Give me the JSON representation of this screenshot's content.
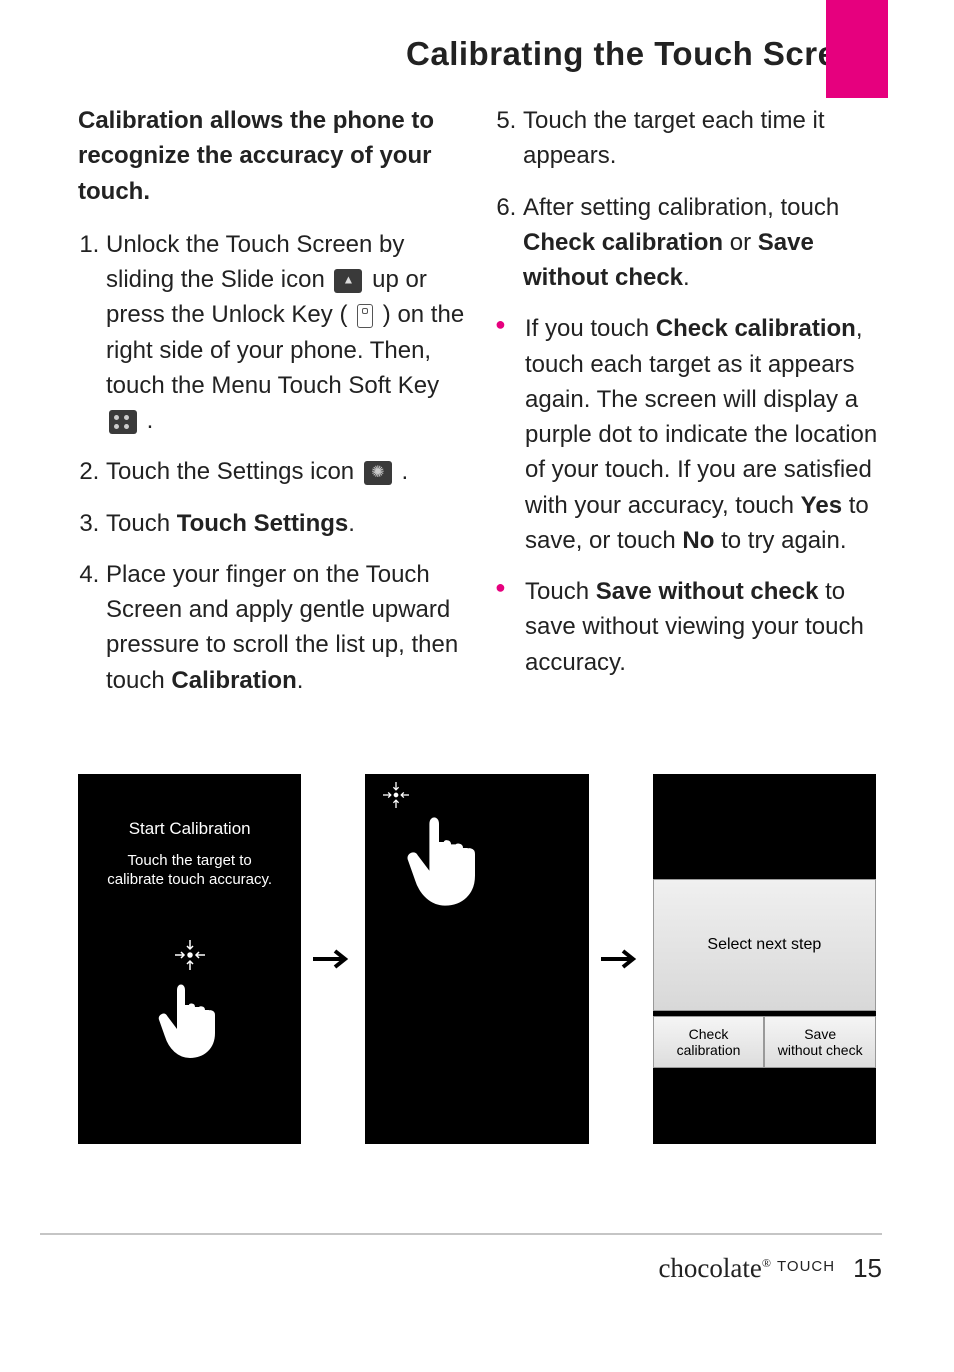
{
  "title": "Calibrating the Touch Screen",
  "intro": "Calibration allows the phone to recognize the accuracy of your touch.",
  "steps": {
    "s1a": "Unlock the Touch Screen by sliding the Slide icon ",
    "s1b": " up or press the Unlock Key ( ",
    "s1c": " ) on the right side of your phone. Then, touch the Menu Touch Soft Key ",
    "s1d": " .",
    "s2a": "Touch the Settings icon ",
    "s2b": " .",
    "s3a": "Touch ",
    "s3b": "Touch Settings",
    "s3c": ".",
    "s4a": "Place your finger on the Touch Screen and apply gentle upward pressure to scroll the list up, then touch ",
    "s4b": "Calibration",
    "s4c": ".",
    "s5": "Touch the target each time it appears.",
    "s6a": " After setting calibration, touch ",
    "s6b": "Check calibration",
    "s6c": " or ",
    "s6d": "Save without check",
    "s6e": "."
  },
  "bullets": {
    "b1a": "If you touch ",
    "b1b": "Check calibration",
    "b1c": ", touch each target as it appears again.  The screen will display a purple dot to indicate the location of your touch.  If you are satisfied with your accuracy, touch ",
    "b1d": "Yes",
    "b1e": " to save, or touch ",
    "b1f": "No",
    "b1g": " to try again.",
    "b2a": "Touch ",
    "b2b": "Save without check",
    "b2c": " to save without viewing your touch accuracy."
  },
  "diagram": {
    "phone1_title": "Start Calibration",
    "phone1_sub": "Touch the target to\ncalibrate touch accuracy.",
    "phone3_dialog": "Select next step",
    "phone3_btn1": "Check\ncalibration",
    "phone3_btn2": "Save\nwithout check"
  },
  "footer": {
    "brand": "chocolate",
    "brand_sub": "TOUCH",
    "reg": "®",
    "page": "15"
  }
}
